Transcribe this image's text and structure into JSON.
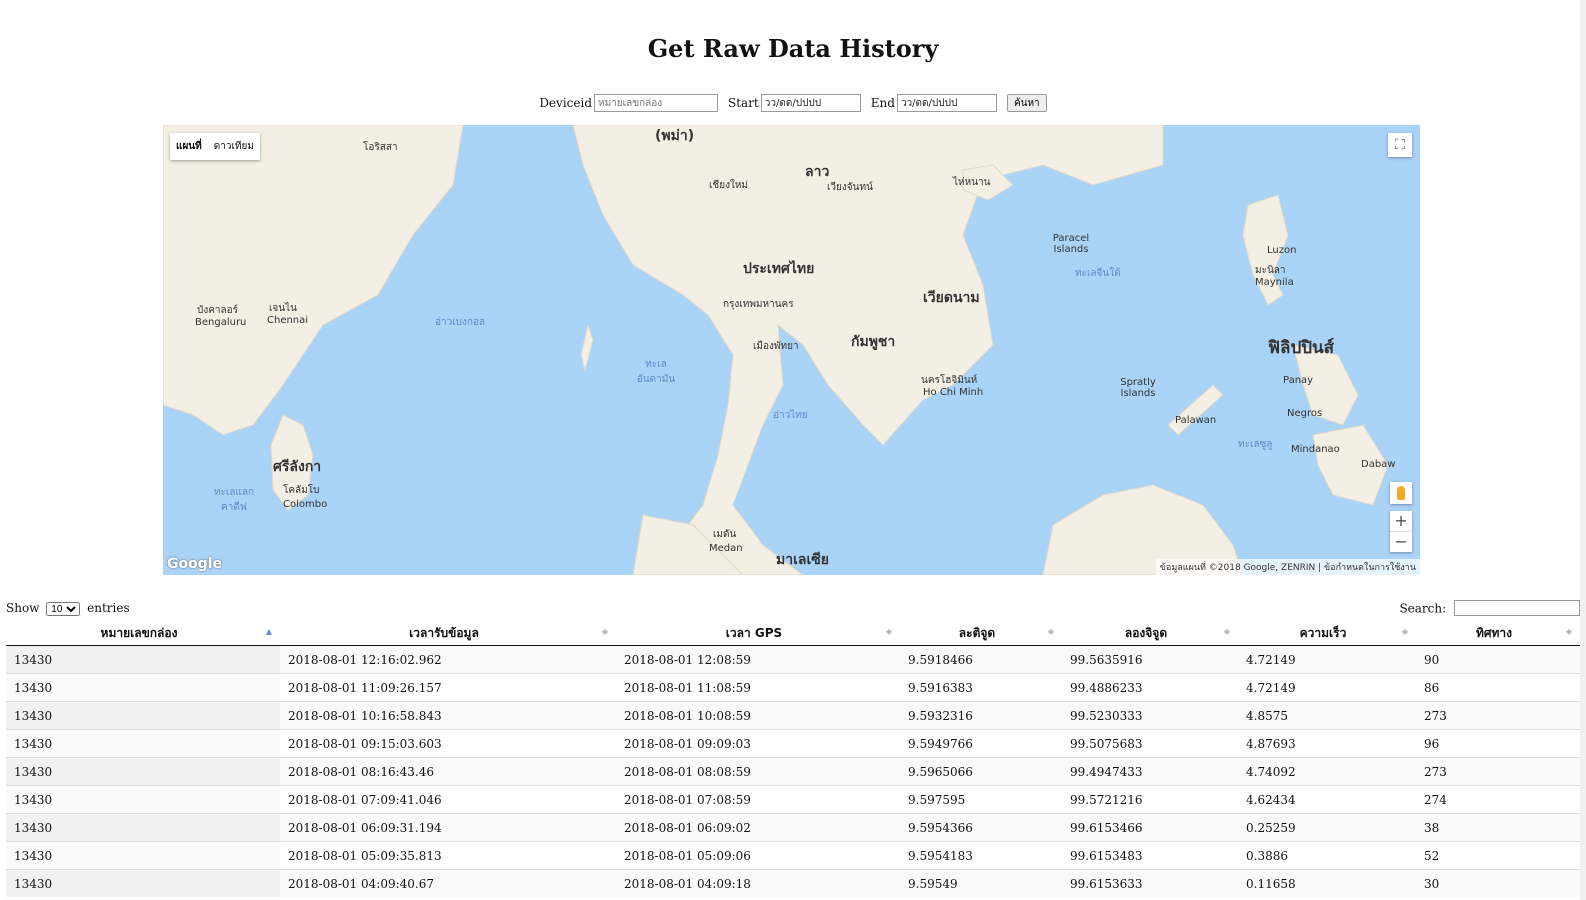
{
  "page": {
    "title": "Get Raw Data History"
  },
  "form": {
    "deviceid_label": "Deviceid",
    "deviceid_placeholder": "หมายเลขกล่อง",
    "start_label": "Start",
    "start_value": "วว/ดด/ปปปป",
    "end_label": "End",
    "end_value": "วว/ดด/ปปปป",
    "search_button": "ค้นหา"
  },
  "map": {
    "type_map": "แผนที่",
    "type_satellite": "ดาวเทียม",
    "google_logo": "Google",
    "attribution": "ข้อมูลแผนที่ ©2018 Google, ZENRIN | ข้อกำหนดในการใช้งาน",
    "labels": {
      "myanmar": "(พม่า)",
      "laos": "ลาว",
      "thailand": "ประเทศไทย",
      "vietnam": "เวียดนาม",
      "cambodia": "กัมพูชา",
      "philippines": "ฟิลิปปินส์",
      "srilanka": "ศรีลังกา",
      "malaysia": "มาเลเซีย",
      "bangkok": "กรุงเทพมหานคร",
      "hcmc": "นครโฮจิมินห์",
      "hcmc_en": "Ho Chi Minh",
      "manila": "มะนิลา",
      "manila_en": "Maynila",
      "chennai": "เจนไน",
      "chennai_en": "Chennai",
      "bengaluru": "บังคาลอร์",
      "bengaluru_en": "Bengaluru",
      "colombo": "โคลัมโบ",
      "colombo_en": "Colombo",
      "medan": "เมดัน",
      "medan_en": "Medan",
      "vientiane": "เวียงจันทน์",
      "chiangmai": "เชียงใหม่",
      "pattaya": "เมืองพัทยา",
      "odisha": "โอริสสา",
      "bay_of_bengal": "อ่าวเบงกอล",
      "andaman": "ทะเลอันดามัน",
      "gulf_thailand": "อ่าวไทย",
      "south_china_sea": "ทะเลจีนใต้",
      "sulu": "ทะเลซูลู",
      "laccadive": "ทะเลแลกคาดีฟ",
      "paracel": "Paracel Islands",
      "spratly": "Spratly Islands",
      "palawan": "Palawan",
      "luzon": "Luzon",
      "mindanao": "Mindanao",
      "davao": "Dabaw",
      "negros": "Negros",
      "panay": "Panay",
      "hainan": "ไห่หนาน"
    }
  },
  "table": {
    "show_label": "Show",
    "page_size": "10",
    "entries_label": "entries",
    "search_label": "Search:",
    "columns": [
      "หมายเลขกล่อง",
      "เวลารับข้อมูล",
      "เวลา GPS",
      "ละติจูด",
      "ลองจิจูด",
      "ความเร็ว",
      "ทิศทาง"
    ],
    "rows": [
      [
        "13430",
        "2018-08-01 12:16:02.962",
        "2018-08-01 12:08:59",
        "9.5918466",
        "99.5635916",
        "4.72149",
        "90"
      ],
      [
        "13430",
        "2018-08-01 11:09:26.157",
        "2018-08-01 11:08:59",
        "9.5916383",
        "99.4886233",
        "4.72149",
        "86"
      ],
      [
        "13430",
        "2018-08-01 10:16:58.843",
        "2018-08-01 10:08:59",
        "9.5932316",
        "99.5230333",
        "4.8575",
        "273"
      ],
      [
        "13430",
        "2018-08-01 09:15:03.603",
        "2018-08-01 09:09:03",
        "9.5949766",
        "99.5075683",
        "4.87693",
        "96"
      ],
      [
        "13430",
        "2018-08-01 08:16:43.46",
        "2018-08-01 08:08:59",
        "9.5965066",
        "99.4947433",
        "4.74092",
        "273"
      ],
      [
        "13430",
        "2018-08-01 07:09:41.046",
        "2018-08-01 07:08:59",
        "9.597595",
        "99.5721216",
        "4.62434",
        "274"
      ],
      [
        "13430",
        "2018-08-01 06:09:31.194",
        "2018-08-01 06:09:02",
        "9.5954366",
        "99.6153466",
        "0.25259",
        "38"
      ],
      [
        "13430",
        "2018-08-01 05:09:35.813",
        "2018-08-01 05:09:06",
        "9.5954183",
        "99.6153483",
        "0.3886",
        "52"
      ],
      [
        "13430",
        "2018-08-01 04:09:40.67",
        "2018-08-01 04:09:18",
        "9.59549",
        "99.6153633",
        "0.11658",
        "30"
      ]
    ]
  }
}
